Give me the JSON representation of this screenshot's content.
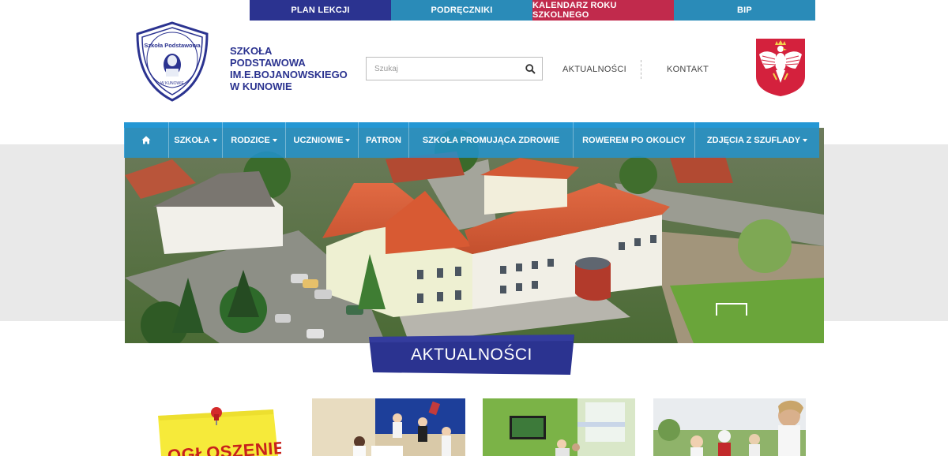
{
  "topbar": {
    "items": [
      {
        "label": "PLAN LEKCJI"
      },
      {
        "label": "PODRĘCZNIKI"
      },
      {
        "label": "KALENDARZ ROKU SZKOLNEGO"
      },
      {
        "label": "BIP"
      }
    ]
  },
  "header": {
    "logo_text_top": "Szkoła Podstawowa",
    "logo_text_bottom": "W KUNOWIE",
    "school_name_lines": [
      "SZKOŁA",
      "PODSTAWOWA",
      "IM.E.BOJANOWSKIEGO",
      "W KUNOWIE"
    ],
    "search": {
      "placeholder": "Szukaj"
    },
    "links": [
      {
        "label": "AKTUALNOŚCI"
      },
      {
        "label": "KONTAKT"
      }
    ]
  },
  "nav": {
    "items": [
      {
        "label": "",
        "icon": "home-icon"
      },
      {
        "label": "SZKOŁA",
        "dropdown": true
      },
      {
        "label": "RODZICE",
        "dropdown": true
      },
      {
        "label": "UCZNIOWIE",
        "dropdown": true
      },
      {
        "label": "PATRON",
        "dropdown": false
      },
      {
        "label": "SZKOŁA PROMUJĄCA ZDROWIE",
        "dropdown": false
      },
      {
        "label": "ROWEREM PO OKOLICY",
        "dropdown": false
      },
      {
        "label": "ZDJĘCIA Z SZUFLADY",
        "dropdown": true
      }
    ]
  },
  "section": {
    "title": "AKTUALNOŚCI"
  },
  "news": {
    "first_note_label": "OGŁOSZENIE"
  },
  "colors": {
    "navy": "#2b3390",
    "teal": "#2a8bb8",
    "crimson": "#c12a4c",
    "nav_blue": "#2094d2"
  }
}
